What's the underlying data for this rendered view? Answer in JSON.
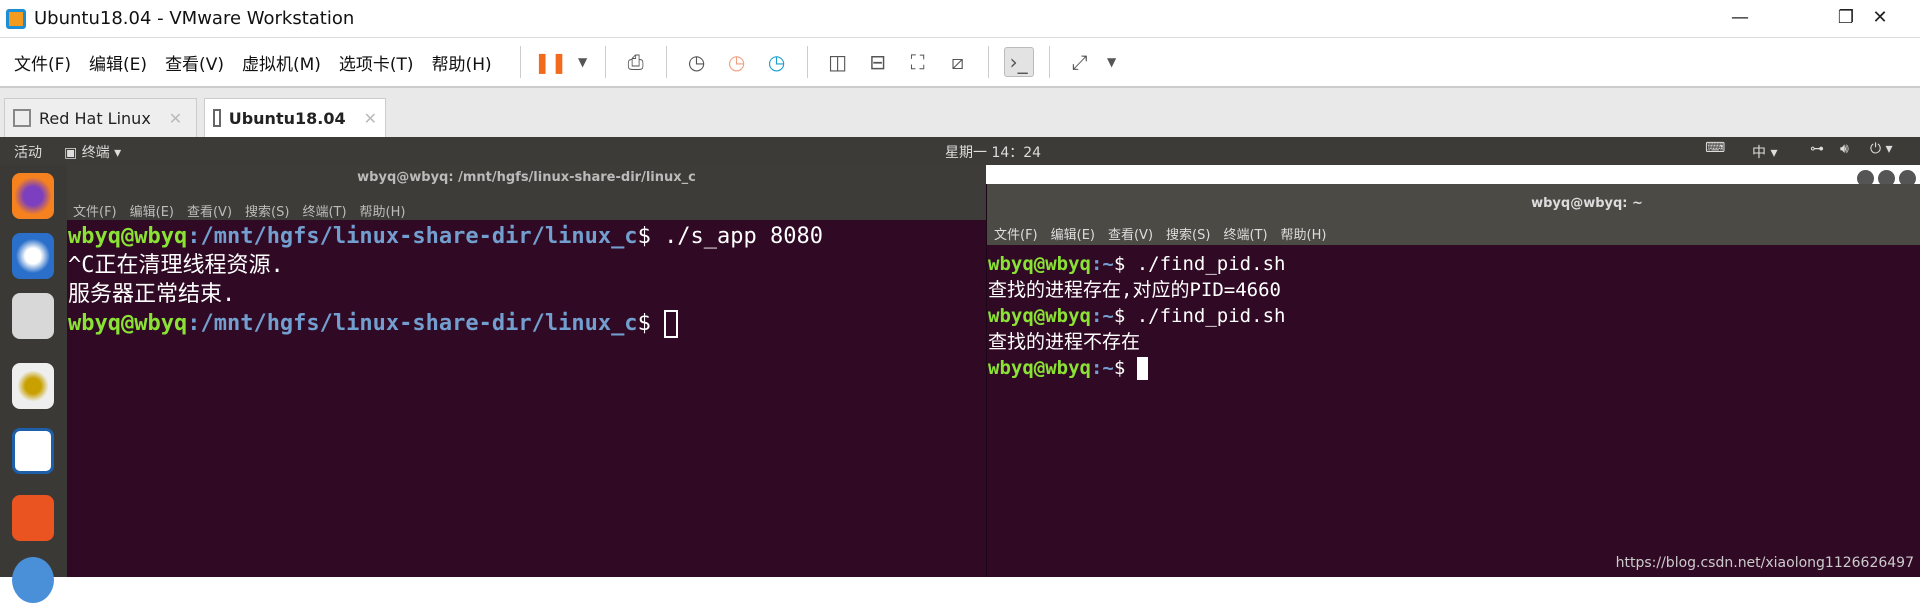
{
  "window": {
    "title": "Ubuntu18.04 - VMware Workstation",
    "min": "—",
    "max": "❐",
    "close": "✕"
  },
  "menu": [
    "文件(F)",
    "编辑(E)",
    "查看(V)",
    "虚拟机(M)",
    "选项卡(T)",
    "帮助(H)"
  ],
  "tabs": [
    {
      "label": "Red Hat Linux",
      "close": "✕"
    },
    {
      "label": "Ubuntu18.04",
      "close": "✕"
    }
  ],
  "topbar": {
    "activities": "活动",
    "app": "终端 ▾",
    "clock": "星期一 14：24",
    "ime": "中 ▾"
  },
  "left_terminal": {
    "title": "wbyq@wbyq: /mnt/hgfs/linux-share-dir/linux_c",
    "menu": [
      "文件(F)",
      "编辑(E)",
      "查看(V)",
      "搜索(S)",
      "终端(T)",
      "帮助(H)"
    ],
    "user": "wbyq@wbyq",
    "path": ":/mnt/hgfs/linux-share-dir/linux_c",
    "prompt": "$ ",
    "cmd1": "./s_app 8080",
    "out1": "^C正在清理线程资源.",
    "out2": "服务器正常结束."
  },
  "right_terminal": {
    "title": "wbyq@wbyq: ~",
    "menu": [
      "文件(F)",
      "编辑(E)",
      "查看(V)",
      "搜索(S)",
      "终端(T)",
      "帮助(H)"
    ],
    "user": "wbyq@wbyq",
    "path": ":~",
    "prompt": "$ ",
    "cmd": "./find_pid.sh",
    "out1": "查找的进程存在,对应的PID=4660",
    "out2": "查找的进程不存在"
  },
  "watermark": "https://blog.csdn.net/xiaolong1126626497"
}
